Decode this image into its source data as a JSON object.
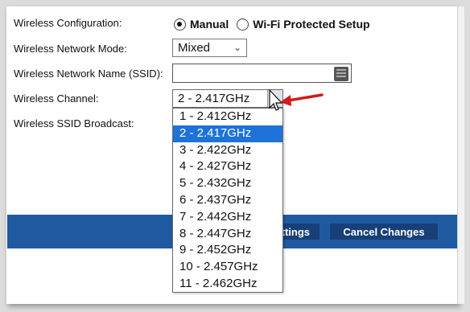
{
  "form": {
    "config_label": "Wireless Configuration:",
    "mode_label": "Wireless Network Mode:",
    "ssid_label": "Wireless Network Name (SSID):",
    "channel_label": "Wireless Channel:",
    "broadcast_label": "Wireless SSID Broadcast:"
  },
  "config": {
    "manual": "Manual",
    "wps": "Wi-Fi Protected Setup",
    "selected": "Manual"
  },
  "mode": {
    "value": "Mixed"
  },
  "ssid": {
    "value": ""
  },
  "channel": {
    "value": "2 - 2.417GHz",
    "options": [
      "1 - 2.412GHz",
      "2 - 2.417GHz",
      "3 - 2.422GHz",
      "4 - 2.427GHz",
      "5 - 2.432GHz",
      "6 - 2.437GHz",
      "7 - 2.442GHz",
      "8 - 2.447GHz",
      "9 - 2.452GHz",
      "10 - 2.457GHz",
      "11 - 2.462GHz"
    ],
    "highlighted_index": 1
  },
  "footer": {
    "save_label": "ttings",
    "cancel_label": "Cancel Changes"
  },
  "colors": {
    "bar": "#1f5aa0",
    "button": "#173f78",
    "highlight": "#1e73d8",
    "annotation_arrow": "#d01c1c"
  },
  "icons": {
    "ssid_field_icon": "password-manager-icon",
    "chevron": "chevron-down-icon",
    "annotation": "red-arrow-icon",
    "cursor": "mouse-pointer-icon"
  }
}
